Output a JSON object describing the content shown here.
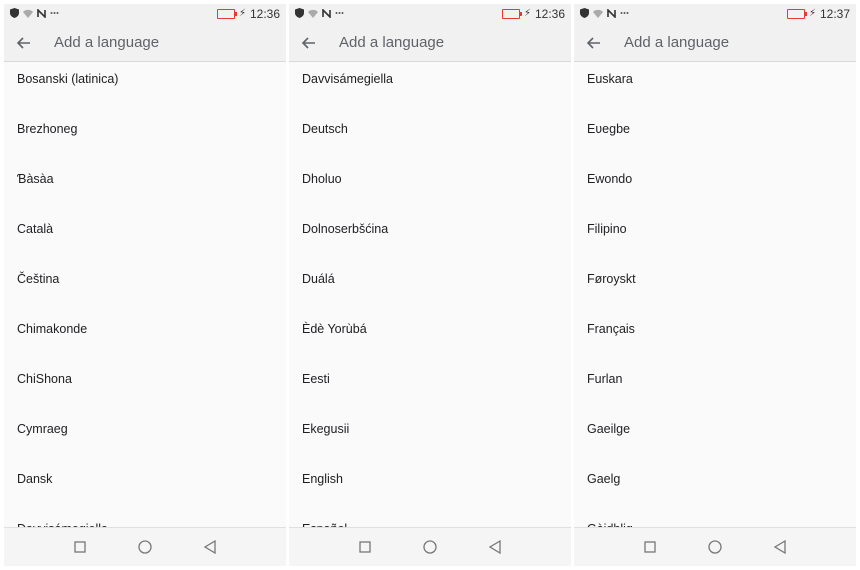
{
  "screens": [
    {
      "status": {
        "time": "12:36"
      },
      "appbar": {
        "title": "Add a language"
      },
      "languages": [
        "Bosanski (latinica)",
        "Brezhoneg",
        "Ɓàsàa",
        "Català",
        "Čeština",
        "Chimakonde",
        "ChiShona",
        "Cymraeg",
        "Dansk",
        "Davvisámegiella"
      ]
    },
    {
      "status": {
        "time": "12:36"
      },
      "appbar": {
        "title": "Add a language"
      },
      "languages": [
        "Davvisámegiella",
        "Deutsch",
        "Dholuo",
        "Dolnoserbšćina",
        "Duálá",
        "Èdè Yorùbá",
        "Eesti",
        "Ekegusii",
        "English",
        "Español"
      ]
    },
    {
      "status": {
        "time": "12:37"
      },
      "appbar": {
        "title": "Add a language"
      },
      "languages": [
        "Euskara",
        "Eʋegbe",
        "Ewondo",
        "Filipino",
        "Føroyskt",
        "Français",
        "Furlan",
        "Gaeilge",
        "Gaelg",
        "Gàidhlig"
      ]
    }
  ],
  "icons": {
    "status_left": [
      "shield-icon",
      "wifi-icon",
      "nfc-icon",
      "more-dots-icon"
    ],
    "status_right": [
      "battery-low-icon",
      "charging-bolt-icon"
    ],
    "back": "arrow-back-icon",
    "nav": [
      "recents-square-icon",
      "home-circle-icon",
      "back-triangle-icon"
    ]
  },
  "colors": {
    "battery": "#e53935",
    "bar_background": "#f1f1f1",
    "list_background": "#fafafa"
  }
}
